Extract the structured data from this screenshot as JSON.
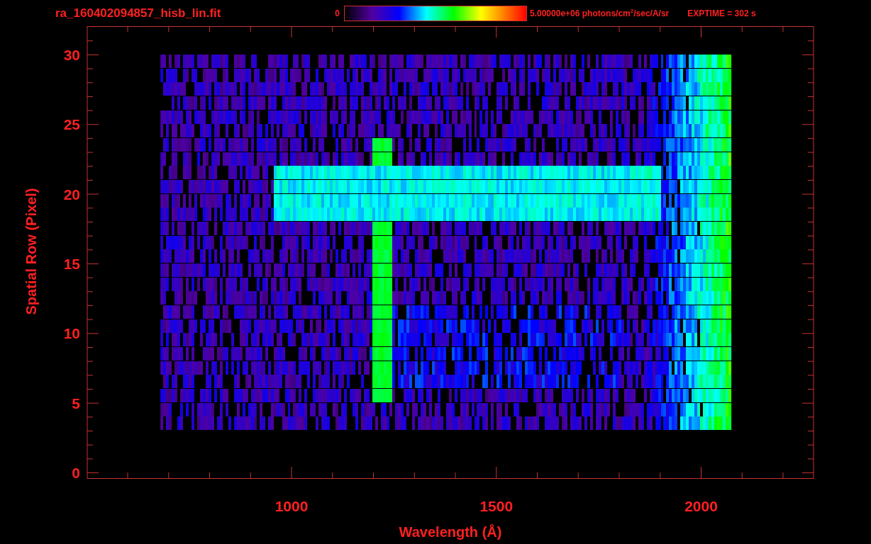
{
  "title": "ra_160402094857_hisb_lin.fit",
  "colorbar": {
    "min_label": "0",
    "max_label": "5.00000e+06 photons/cm$^{2}$/sec/A/sr"
  },
  "exposure": "EXPTIME = 302 s",
  "plot": {
    "xlabel": "Wavelength (Å)",
    "ylabel": "Spatial Row (Pixel)",
    "xticks": [
      "1000",
      "1500",
      "2000"
    ],
    "yticks": [
      "30",
      "25",
      "20",
      "15",
      "10",
      "5",
      "0"
    ]
  }
}
